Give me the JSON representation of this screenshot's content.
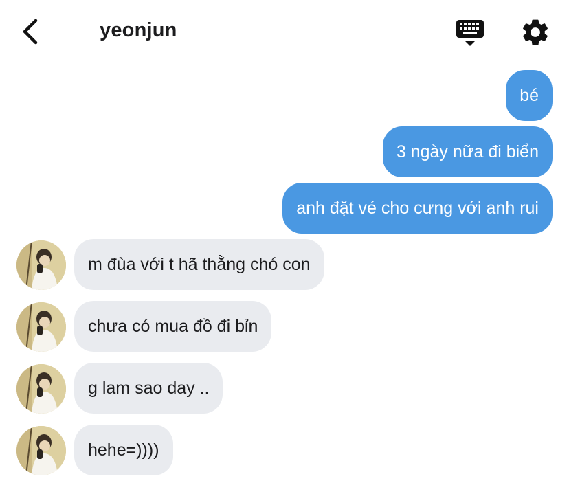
{
  "header": {
    "contact_name": "yeonjun",
    "back_icon": "chevron-left-icon",
    "keyboard_icon": "keyboard-icon",
    "settings_icon": "gear-icon"
  },
  "messages": [
    {
      "direction": "outgoing",
      "text": "bé"
    },
    {
      "direction": "outgoing",
      "text": "3 ngày nữa đi biển"
    },
    {
      "direction": "outgoing",
      "text": "anh đặt vé cho cưng với anh rui"
    },
    {
      "direction": "incoming",
      "text": "m đùa với t hã thằng chó con"
    },
    {
      "direction": "incoming",
      "text": "chưa có mua đồ đi bỉn"
    },
    {
      "direction": "incoming",
      "text": "g lam sao day .."
    },
    {
      "direction": "incoming",
      "text": "hehe=))))"
    }
  ],
  "colors": {
    "outgoing_bubble": "#4a98e2",
    "incoming_bubble": "#e9ebef",
    "background": "#ffffff"
  }
}
